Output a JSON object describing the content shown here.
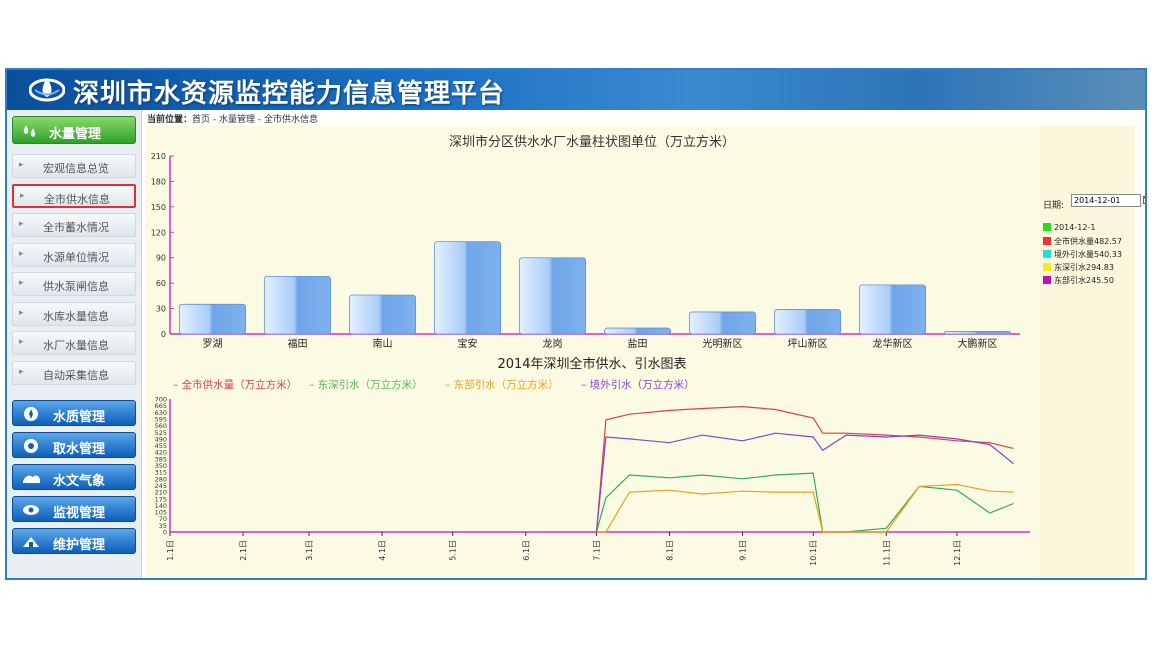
{
  "app": {
    "title": "深圳市水资源监控能力信息管理平台",
    "breadcrumb_label": "当前位置：",
    "breadcrumb_path": "首页 - 水量管理 - 全市供水信息"
  },
  "sidebar": {
    "active_group": "水量管理",
    "items": [
      {
        "label": "宏观信息总览"
      },
      {
        "label": "全市供水信息",
        "active": true
      },
      {
        "label": "全市蓄水情况"
      },
      {
        "label": "水源单位情况"
      },
      {
        "label": "供水泵闸信息"
      },
      {
        "label": "水库水量信息"
      },
      {
        "label": "水厂水量信息"
      },
      {
        "label": "自动采集信息"
      }
    ],
    "groups": [
      {
        "label": "水质管理",
        "icon": "water-quality-icon"
      },
      {
        "label": "取水管理",
        "icon": "water-intake-icon"
      },
      {
        "label": "水文气象",
        "icon": "weather-icon"
      },
      {
        "label": "监视管理",
        "icon": "camera-icon"
      },
      {
        "label": "维护管理",
        "icon": "maintenance-icon"
      }
    ]
  },
  "filter": {
    "date_label": "日期:",
    "date_value": "2014-12-01",
    "legend": [
      {
        "label": "2014-12-1",
        "color": "#22dd22"
      },
      {
        "label": "全市供水量482.57",
        "color": "#ee3333"
      },
      {
        "label": "境外引水量540.33",
        "color": "#22dddd"
      },
      {
        "label": "东深引水294.83",
        "color": "#eeee22"
      },
      {
        "label": "东部引水245.50",
        "color": "#bb11bb"
      }
    ]
  },
  "chart_data": [
    {
      "type": "bar",
      "title": "深圳市分区供水水厂水量柱状图单位（万立方米）",
      "categories": [
        "罗湖",
        "福田",
        "南山",
        "宝安",
        "龙岗",
        "盐田",
        "光明新区",
        "坪山新区",
        "龙华新区",
        "大鹏新区"
      ],
      "values": [
        35,
        68,
        46,
        109,
        90,
        7,
        26,
        29,
        58,
        3
      ],
      "ylim": [
        0,
        210
      ],
      "yticks": [
        0,
        30,
        60,
        90,
        120,
        150,
        180,
        210
      ],
      "colors": {
        "bar": "#7fb1ec",
        "axis": "#cc33cc"
      }
    },
    {
      "type": "line",
      "title": "2014年深圳全市供水、引水图表",
      "series": [
        {
          "name": "全市供水量（万立方米）",
          "color": "#e04040",
          "legend_color": "#e04040",
          "x": [
            "7.1日",
            "7.5日",
            "7.15日",
            "8.1日",
            "8.15日",
            "9.1日",
            "9.15日",
            "10.1日",
            "10.5日",
            "10.15日",
            "11.1日",
            "11.15日",
            "12.1日",
            "12.15日",
            "12.25日"
          ],
          "values": [
            0,
            590,
            620,
            640,
            650,
            660,
            645,
            600,
            520,
            520,
            510,
            500,
            480,
            470,
            440
          ]
        },
        {
          "name": "东深引水（万立方米）",
          "color": "#33aa55",
          "legend_color": "#55bb55",
          "x": [
            "7.1日",
            "7.5日",
            "7.15日",
            "8.1日",
            "8.15日",
            "9.1日",
            "9.15日",
            "10.1日",
            "10.5日",
            "10.15日",
            "11.1日",
            "11.15日",
            "12.1日",
            "12.15日",
            "12.25日"
          ],
          "values": [
            0,
            180,
            300,
            285,
            300,
            280,
            300,
            310,
            0,
            0,
            20,
            240,
            220,
            100,
            150
          ]
        },
        {
          "name": "东部引水（万立方米）",
          "color": "#f0a020",
          "legend_color": "#f0a020",
          "x": [
            "7.1日",
            "7.5日",
            "7.15日",
            "8.1日",
            "8.15日",
            "9.1日",
            "9.15日",
            "10.1日",
            "10.5日",
            "10.15日",
            "11.1日",
            "11.15日",
            "12.1日",
            "12.15日",
            "12.25日"
          ],
          "values": [
            0,
            0,
            210,
            220,
            200,
            215,
            210,
            210,
            0,
            0,
            0,
            240,
            250,
            215,
            210
          ]
        },
        {
          "name": "境外引水（万立方米）",
          "color": "#8844cc",
          "legend_color": "#8844cc",
          "x": [
            "7.1日",
            "7.5日",
            "7.15日",
            "8.1日",
            "8.15日",
            "9.1日",
            "9.15日",
            "10.1日",
            "10.5日",
            "10.15日",
            "11.1日",
            "11.15日",
            "12.1日",
            "12.15日",
            "12.25日"
          ],
          "values": [
            0,
            500,
            490,
            470,
            510,
            480,
            520,
            500,
            430,
            510,
            500,
            510,
            490,
            460,
            360
          ]
        }
      ],
      "xticks": [
        "1.1日",
        "2.1日",
        "3.1日",
        "4.1日",
        "5.1日",
        "6.1日",
        "7.1日",
        "8.1日",
        "9.1日",
        "10.1日",
        "11.1日",
        "12.1日"
      ],
      "ylim": [
        0,
        700
      ],
      "yticks": [
        0,
        35,
        70,
        105,
        140,
        175,
        210,
        245,
        280,
        315,
        350,
        385,
        420,
        455,
        490,
        525,
        560,
        595,
        630,
        665,
        700
      ]
    }
  ]
}
